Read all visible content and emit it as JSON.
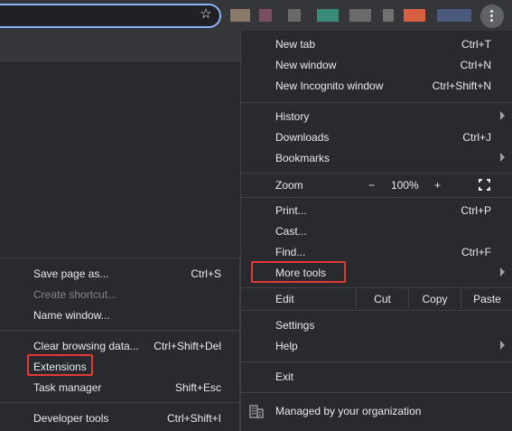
{
  "toolbar": {
    "extension_colors": [
      "#8a7a6a",
      "#7a5060",
      "#6a6a6a",
      "#3a8a78",
      "#6a6a6a",
      "#707070",
      "#d86040",
      "#4a5a7a"
    ]
  },
  "menu": {
    "new_tab": {
      "label": "New tab",
      "shortcut": "Ctrl+T"
    },
    "new_window": {
      "label": "New window",
      "shortcut": "Ctrl+N"
    },
    "new_incognito": {
      "label": "New Incognito window",
      "shortcut": "Ctrl+Shift+N"
    },
    "history": {
      "label": "History"
    },
    "downloads": {
      "label": "Downloads",
      "shortcut": "Ctrl+J"
    },
    "bookmarks": {
      "label": "Bookmarks"
    },
    "zoom": {
      "label": "Zoom",
      "minus": "−",
      "value": "100%",
      "plus": "+"
    },
    "print": {
      "label": "Print...",
      "shortcut": "Ctrl+P"
    },
    "cast": {
      "label": "Cast..."
    },
    "find": {
      "label": "Find...",
      "shortcut": "Ctrl+F"
    },
    "more_tools": {
      "label": "More tools"
    },
    "edit": {
      "label": "Edit",
      "cut": "Cut",
      "copy": "Copy",
      "paste": "Paste"
    },
    "settings": {
      "label": "Settings"
    },
    "help": {
      "label": "Help"
    },
    "exit": {
      "label": "Exit"
    },
    "managed": {
      "label": "Managed by your organization"
    }
  },
  "submenu": {
    "save_page": {
      "label": "Save page as...",
      "shortcut": "Ctrl+S"
    },
    "create_shortcut": {
      "label": "Create shortcut..."
    },
    "name_window": {
      "label": "Name window..."
    },
    "clear_browsing": {
      "label": "Clear browsing data...",
      "shortcut": "Ctrl+Shift+Del"
    },
    "extensions": {
      "label": "Extensions"
    },
    "task_manager": {
      "label": "Task manager",
      "shortcut": "Shift+Esc"
    },
    "developer_tools": {
      "label": "Developer tools",
      "shortcut": "Ctrl+Shift+I"
    }
  },
  "icons": {
    "star": "☆"
  },
  "colors": {
    "highlight": "#e53935",
    "menu_bg": "#292a2d",
    "focus_ring": "#8ab4f8"
  }
}
